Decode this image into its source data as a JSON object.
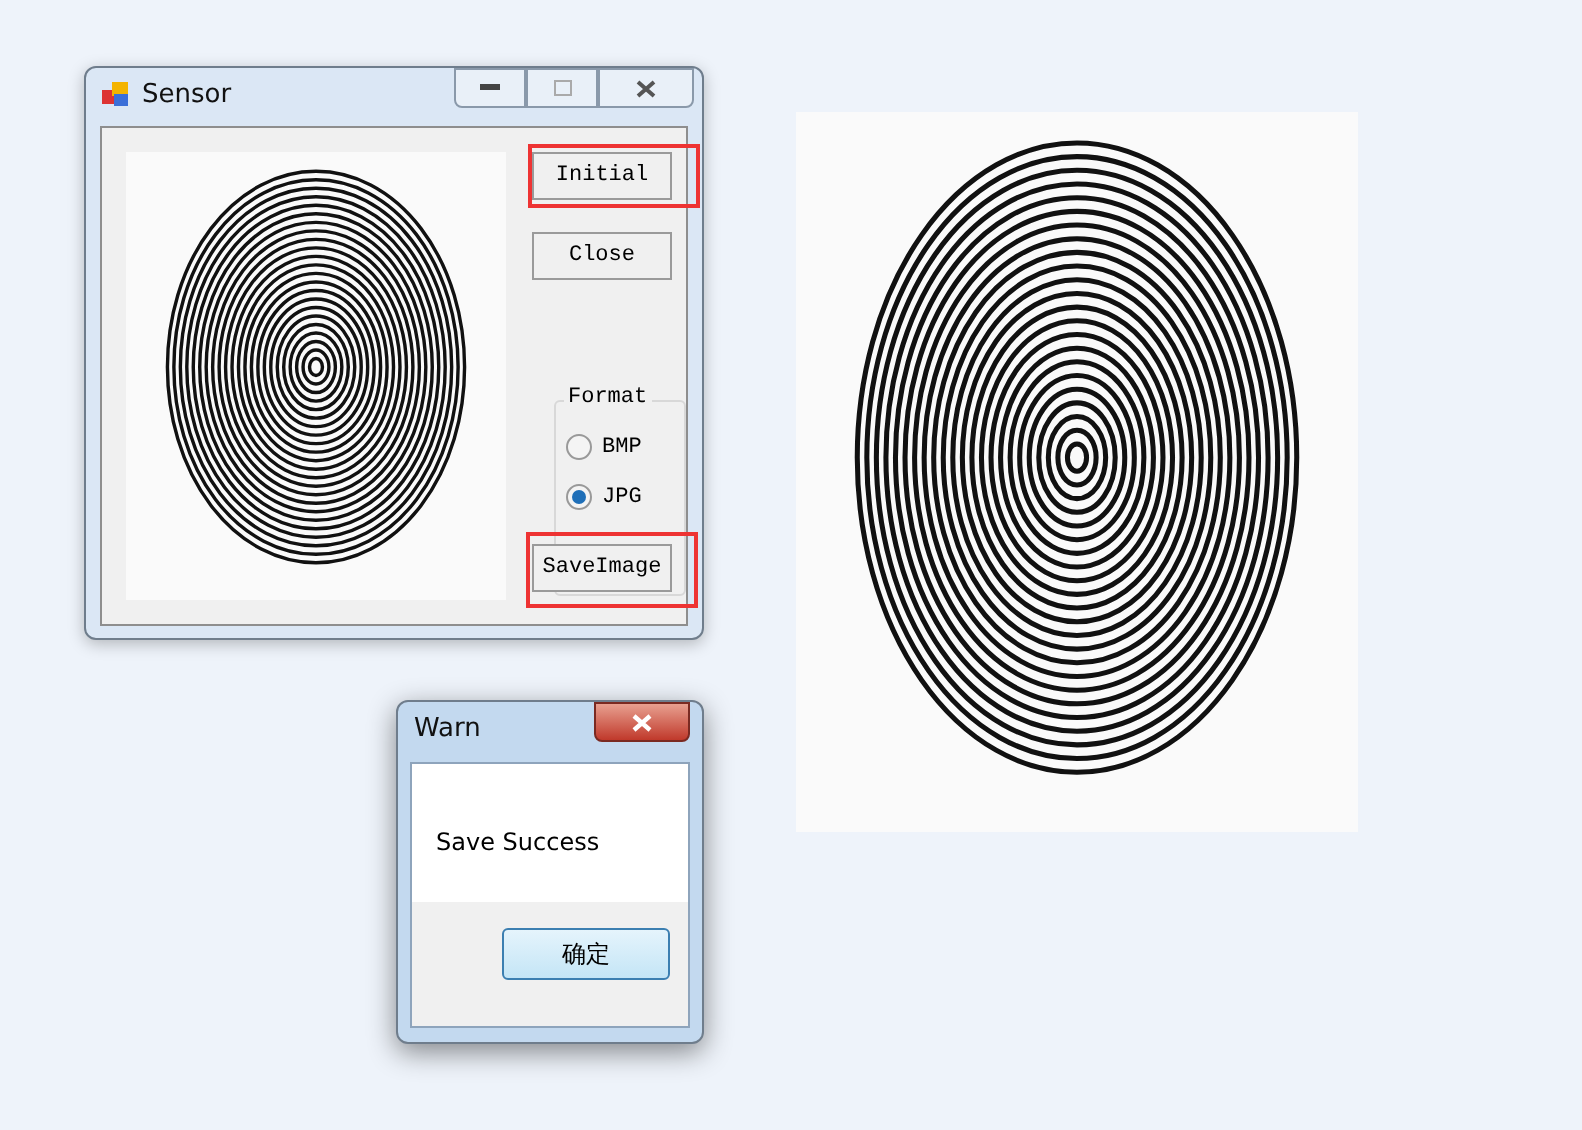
{
  "sensor_window": {
    "title": "Sensor",
    "buttons": [
      {
        "label": "Initial",
        "highlighted": true
      },
      {
        "label": "Close",
        "highlighted": false
      }
    ],
    "format_group": {
      "title": "Format",
      "options": [
        {
          "label": "BMP",
          "selected": false
        },
        {
          "label": "JPG",
          "selected": true
        }
      ]
    },
    "save_button": {
      "label": "SaveImage",
      "highlighted": true
    }
  },
  "warn_dialog": {
    "title": "Warn",
    "message": "Save Success",
    "ok_button": "确定"
  }
}
